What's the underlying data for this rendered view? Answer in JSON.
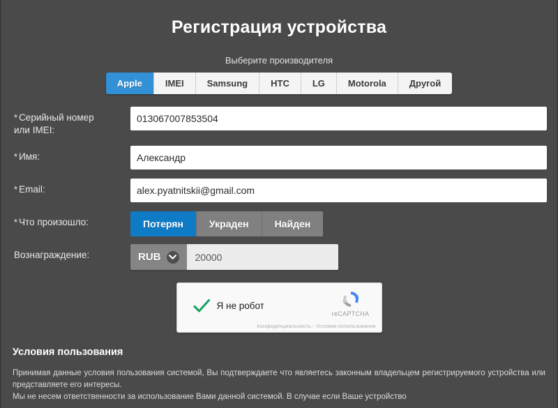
{
  "header": {
    "title": "Регистрация устройства"
  },
  "manufacturer": {
    "hint": "Выберите производителя",
    "selected": "Apple",
    "options": [
      {
        "label": "Apple"
      },
      {
        "label": "IMEI"
      },
      {
        "label": "Samsung"
      },
      {
        "label": "HTC"
      },
      {
        "label": "LG"
      },
      {
        "label": "Motorola"
      },
      {
        "label": "Другой"
      }
    ]
  },
  "form": {
    "serial": {
      "label_line1": "Серийный номер",
      "label_line2": "или IMEI:",
      "required_mark": "*",
      "value": "013067007853504",
      "placeholder": ""
    },
    "name": {
      "label": "Имя:",
      "required_mark": "*",
      "value": "Александр",
      "placeholder": ""
    },
    "email": {
      "label": "Email:",
      "required_mark": "*",
      "value": "alex.pyatnitskii@gmail.com",
      "placeholder": ""
    },
    "status": {
      "label": "Что произошло:",
      "required_mark": "*",
      "selected": "Потерян",
      "options": [
        {
          "label": "Потерян"
        },
        {
          "label": "Украден"
        },
        {
          "label": "Найден"
        }
      ]
    },
    "reward": {
      "label": "Вознаграждение:",
      "currency": "RUB",
      "currency_icon": "chevron-down-icon",
      "value": "20000",
      "placeholder": ""
    }
  },
  "captcha": {
    "label": "Я не робот",
    "checked": true,
    "check_icon": "checkmark-icon",
    "brand_icon": "recaptcha-logo-icon",
    "brand_name": "reCAPTCHA",
    "terms": "Конфиденциальность - Условия использования"
  },
  "terms": {
    "title": "Условия пользования",
    "paragraph1": "Принимая данные условия пользования системой, Вы подтверждаете что являетесь законным владельцем регистрируемого устройства или представляете его интересы.",
    "paragraph2": "Мы не несем ответственности за использование Вами данной системой. В случае если Ваше устройство"
  },
  "colors": {
    "background": "#4a4a4a",
    "accent_tab": "#3290d6",
    "accent_button": "#0f7ac5",
    "segment_inactive": "#808080",
    "input_background": "#ffffff",
    "check_green": "#1aa260"
  }
}
